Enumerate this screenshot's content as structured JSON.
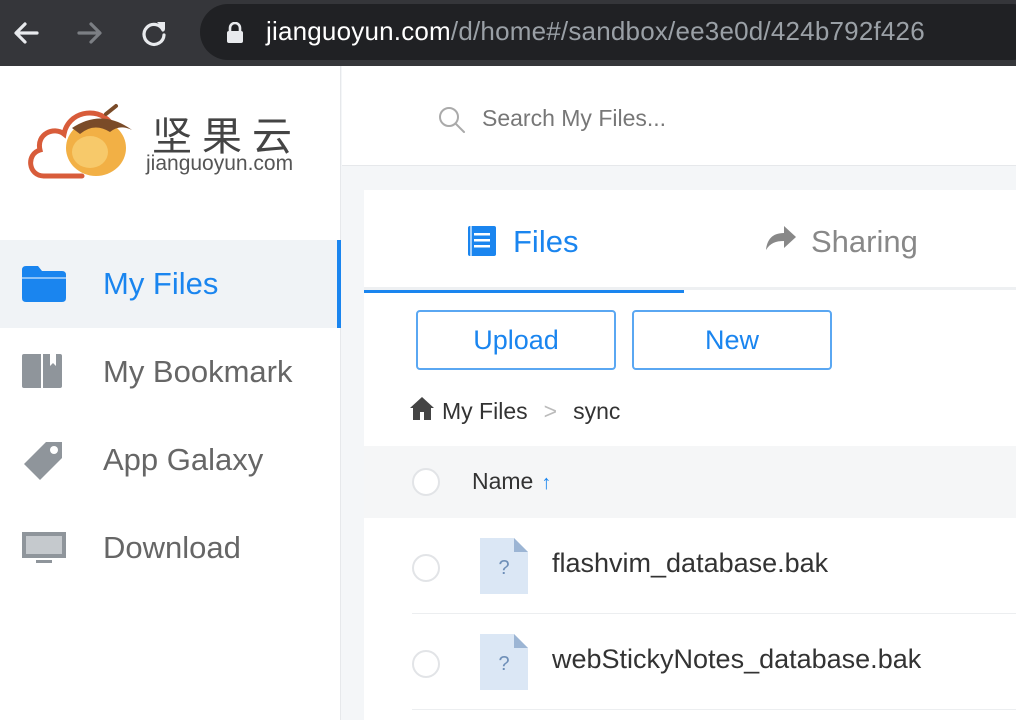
{
  "browser": {
    "url_host": "jianguoyun.com",
    "url_path": "/d/home#/sandbox/ee3e0d/424b792f426"
  },
  "logo": {
    "chinese": "坚果云",
    "english": "jianguoyun.com"
  },
  "sidebar": {
    "items": [
      {
        "label": "My Files",
        "icon": "folder-icon",
        "active": true
      },
      {
        "label": "My Bookmark",
        "icon": "bookmark-icon",
        "active": false
      },
      {
        "label": "App Galaxy",
        "icon": "tag-icon",
        "active": false
      },
      {
        "label": "Download",
        "icon": "monitor-icon",
        "active": false
      }
    ]
  },
  "search": {
    "placeholder": "Search My Files..."
  },
  "tabs": [
    {
      "label": "Files",
      "icon": "document-icon",
      "active": true
    },
    {
      "label": "Sharing",
      "icon": "share-arrow-icon",
      "active": false
    }
  ],
  "toolbar": {
    "upload_label": "Upload",
    "new_label": "New"
  },
  "breadcrumb": {
    "root": "My Files",
    "separator": ">",
    "current": "sync"
  },
  "table": {
    "name_header": "Name",
    "sort_indicator": "↑",
    "rows": [
      {
        "name": "flashvim_database.bak",
        "icon_glyph": "?"
      },
      {
        "name": "webStickyNotes_database.bak",
        "icon_glyph": "?"
      }
    ]
  },
  "colors": {
    "accent": "#1a85ef",
    "browser_bar": "#35363a",
    "url_pill": "#202124"
  }
}
